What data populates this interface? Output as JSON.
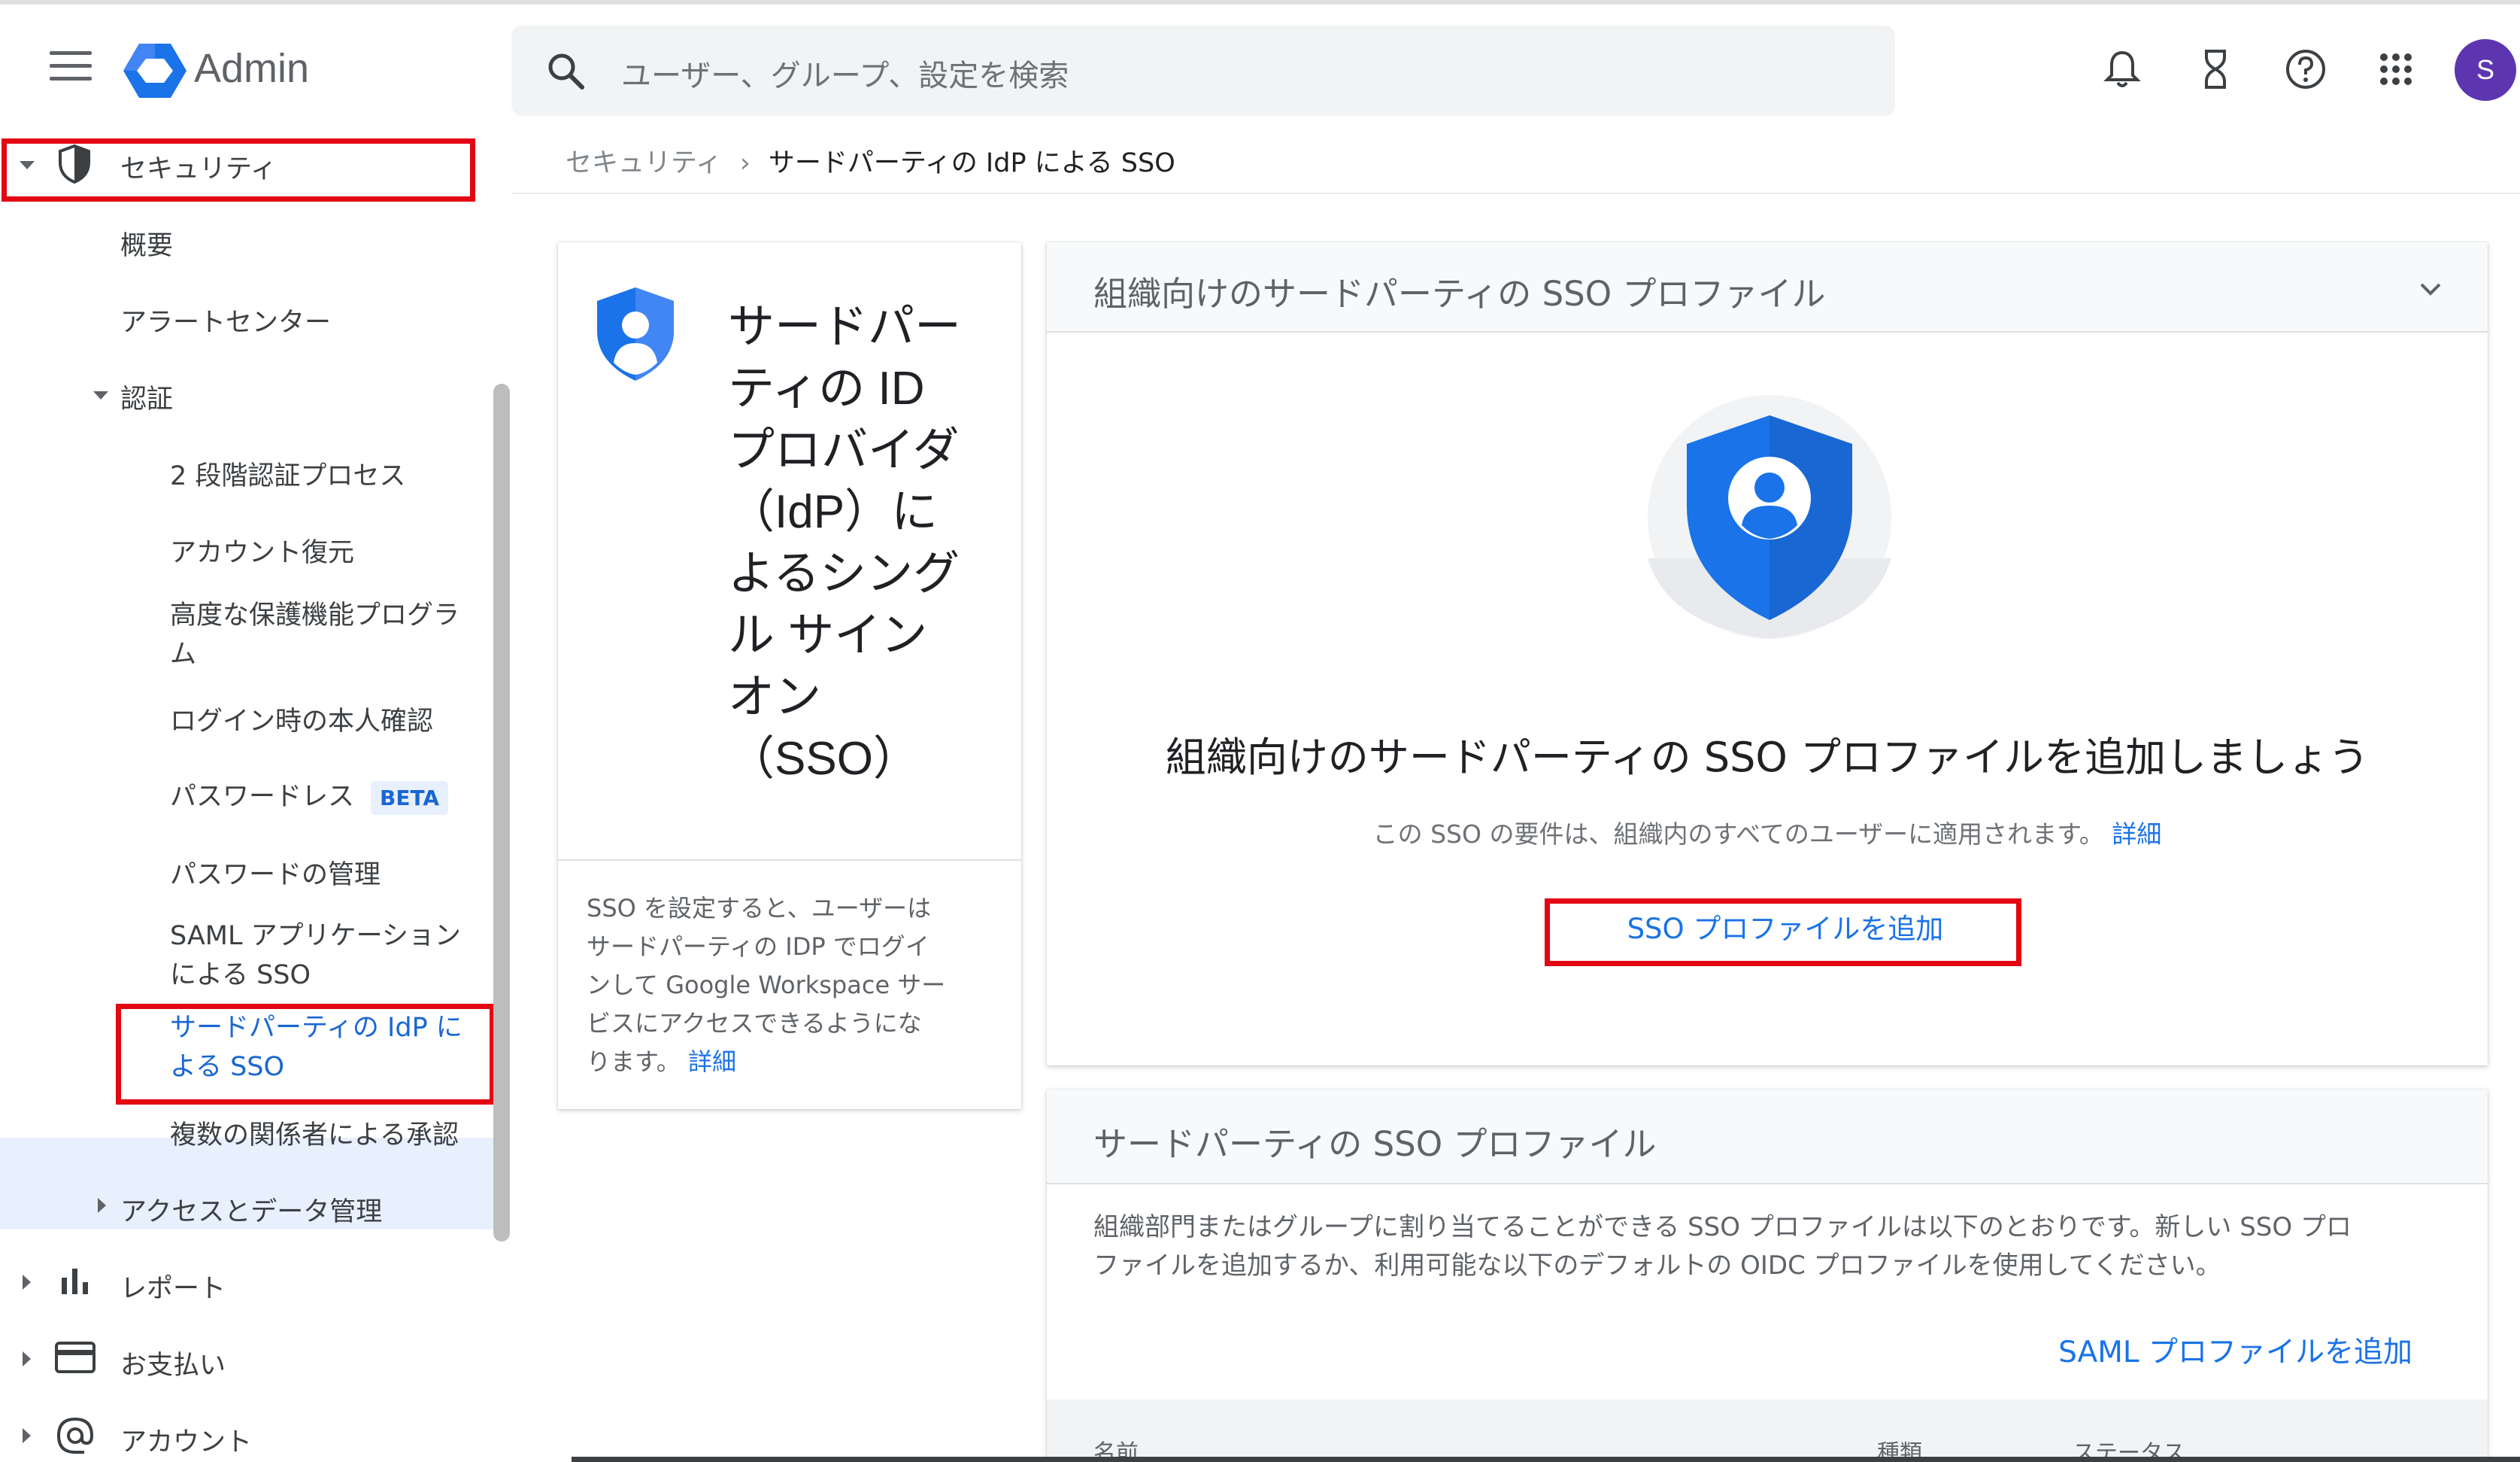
{
  "header": {
    "brand": "Admin",
    "search_placeholder": "ユーザー、グループ、設定を検索",
    "avatar_initial": "S"
  },
  "sidebar": {
    "security": "セキュリティ",
    "overview": "概要",
    "alert_center": "アラートセンター",
    "authentication": "認証",
    "two_step": "2 段階認証プロセス",
    "account_recovery": "アカウント復元",
    "advanced_protection_line1": "高度な保護機能プログラ",
    "advanced_protection_line2": "ム",
    "login_challenge": "ログイン時の本人確認",
    "passwordless": "パスワードレス",
    "passwordless_badge": "BETA",
    "password_mgmt": "パスワードの管理",
    "saml_line1": "SAML アプリケーション",
    "saml_line2": "による SSO",
    "third_party_line1": "サードパーティの IdP に",
    "third_party_line2": "よる SSO",
    "multi_party": "複数の関係者による承認",
    "access_data": "アクセスとデータ管理",
    "reports": "レポート",
    "billing": "お支払い",
    "account": "アカウント"
  },
  "breadcrumb": {
    "parent": "セキュリティ",
    "separator": "›",
    "current": "サードパーティの IdP による SSO"
  },
  "info_card": {
    "title_lines": [
      "サードパー",
      "ティの ID",
      "プロバイダ",
      "（IdP）に",
      "よるシング",
      "ル サイン",
      "オン",
      "（SSO）"
    ],
    "desc_lines": [
      "SSO を設定すると、ユーザーは",
      "サードパーティの IDP でログイ",
      "ンして Google Workspace サー",
      "ビスにアクセスできるようにな",
      "ります。"
    ],
    "desc_link": "詳細"
  },
  "main_card": {
    "header_title": "組織向けのサードパーティの SSO プロファイル",
    "headline": "組織向けのサードパーティの SSO プロファイルを追加しましょう",
    "sub": "この SSO の要件は、組織内のすべてのユーザーに適用されます。",
    "sub_link": "詳細",
    "add_button": "SSO プロファイルを追加"
  },
  "list_card": {
    "header_title": "サードパーティの SSO プロファイル",
    "desc_line1": "組織部門またはグループに割り当てることができる SSO プロファイルは以下のとおりです。新しい SSO プロ",
    "desc_line2": "ファイルを追加するか、利用可能な以下のデフォルトの OIDC プロファイルを使用してください。",
    "add_saml": "SAML プロファイルを追加",
    "columns": [
      "名前",
      "種類",
      "ステータス"
    ]
  },
  "colors": {
    "accent_blue": "#1a73e8",
    "highlight_red": "#e30613",
    "active_bg": "#e8f0fe"
  }
}
